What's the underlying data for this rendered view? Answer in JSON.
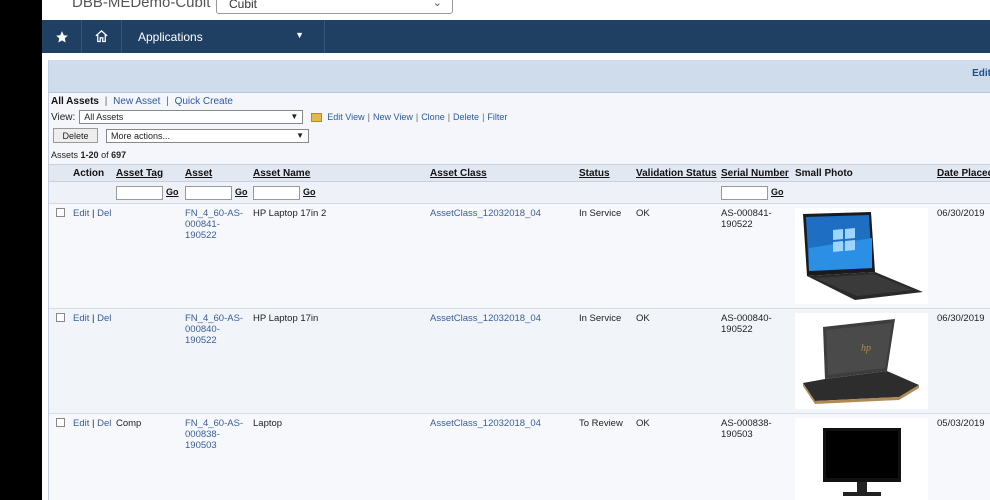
{
  "org": {
    "title": "DBB-MEDemo-Cubit",
    "selected": "Cubit"
  },
  "nav": {
    "apps_label": "Applications"
  },
  "page": {
    "edit_label": "Edit"
  },
  "view_tabs": {
    "current": "All Assets",
    "new_asset": "New Asset",
    "quick_create": "Quick Create"
  },
  "view_bar": {
    "label": "View:",
    "selected": "All Assets",
    "links": [
      "Edit View",
      "New View",
      "Clone",
      "Delete",
      "Filter"
    ]
  },
  "actions": {
    "delete": "Delete",
    "more": "More actions..."
  },
  "count": {
    "prefix": "Assets",
    "range": "1-20",
    "of": "of",
    "total": "697"
  },
  "columns": {
    "action": "Action",
    "asset_tag": "Asset Tag",
    "asset": "Asset",
    "asset_name": "Asset Name",
    "asset_class": "Asset Class",
    "status": "Status",
    "validation_status": "Validation Status",
    "serial_number": "Serial Number",
    "small_photo": "Small Photo",
    "date_placed": "Date Placed"
  },
  "filter_go": "Go",
  "row_actions": {
    "edit": "Edit",
    "sep": "|",
    "del": "Del"
  },
  "rows": [
    {
      "asset_tag": "",
      "asset": [
        "FN_4_60-AS-",
        "000841-",
        "190522"
      ],
      "asset_name": "HP Laptop 17in 2",
      "asset_class": "AssetClass_12032018_04",
      "status": "In Service",
      "validation": "OK",
      "serial": [
        "AS-000841-",
        "190522"
      ],
      "date": "06/30/2019",
      "photo": "laptop-black-photo"
    },
    {
      "asset_tag": "",
      "asset": [
        "FN_4_60-AS-",
        "000840-",
        "190522"
      ],
      "asset_name": "HP Laptop 17in",
      "asset_class": "AssetClass_12032018_04",
      "status": "In Service",
      "validation": "OK",
      "serial": [
        "AS-000840-",
        "190522"
      ],
      "date": "06/30/2019",
      "photo": "laptop-dark-photo"
    },
    {
      "asset_tag": "Comp",
      "asset": [
        "FN_4_60-AS-",
        "000838-",
        "190503"
      ],
      "asset_name": "Laptop",
      "asset_class": "AssetClass_12032018_04",
      "status": "To Review",
      "validation": "OK",
      "serial": [
        "AS-000838-",
        "190503"
      ],
      "date": "05/03/2019",
      "photo": "desktop-monitor-photo"
    }
  ]
}
